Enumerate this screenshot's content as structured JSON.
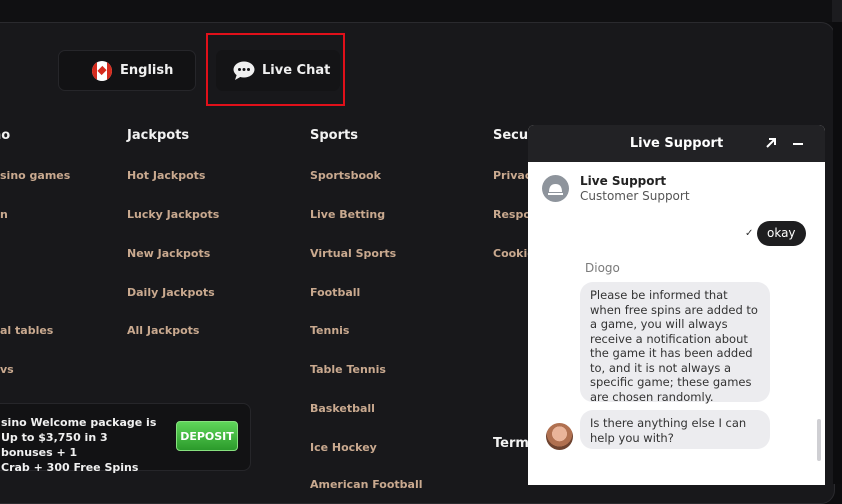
{
  "language_button": {
    "label": "English",
    "icon": "canada-flag-icon"
  },
  "live_chat_button": {
    "label": "Live Chat",
    "icon": "chat-bubble-icon"
  },
  "footer": {
    "columns": [
      {
        "heading": "no",
        "links": [
          "sino games",
          "n",
          "",
          "",
          "al tables",
          "vs"
        ]
      },
      {
        "heading": "Jackpots",
        "links": [
          "Hot Jackpots",
          "Lucky Jackpots",
          "New Jackpots",
          "Daily Jackpots",
          "All Jackpots"
        ]
      },
      {
        "heading": "Sports",
        "links": [
          "Sportsbook",
          "Live Betting",
          "Virtual Sports",
          "Football",
          "Tennis",
          "Table Tennis",
          "Basketball",
          "Ice Hockey",
          "American Football"
        ]
      },
      {
        "heading": "Secur",
        "links": [
          "Privacy",
          "Respor",
          "Cookie"
        ]
      }
    ],
    "terms_heading": "Terms"
  },
  "promo": {
    "line1": "sino Welcome package is",
    "line2": "Up to $3,750 in 3 bonuses + 1",
    "line3": "Crab + 300 Free Spins",
    "button": "DEPOSIT"
  },
  "chat_widget": {
    "title": "Live Support",
    "agent_name": "Live Support",
    "agent_role": "Customer Support",
    "messages": [
      {
        "from": "user",
        "text": "okay"
      },
      {
        "from": "agent",
        "sender": "Diogo",
        "text": "Please be informed that when free spins are added to a game, you will always receive a notification about the game it has been added to, and it is not always a specific game; these games are chosen randomly."
      },
      {
        "from": "agent",
        "text": "Is there anything else I can help you with?"
      }
    ]
  },
  "colors": {
    "accent_link": "#c9a98f",
    "highlight_border": "#e0101a",
    "deposit_green": "#2b9a2b"
  }
}
